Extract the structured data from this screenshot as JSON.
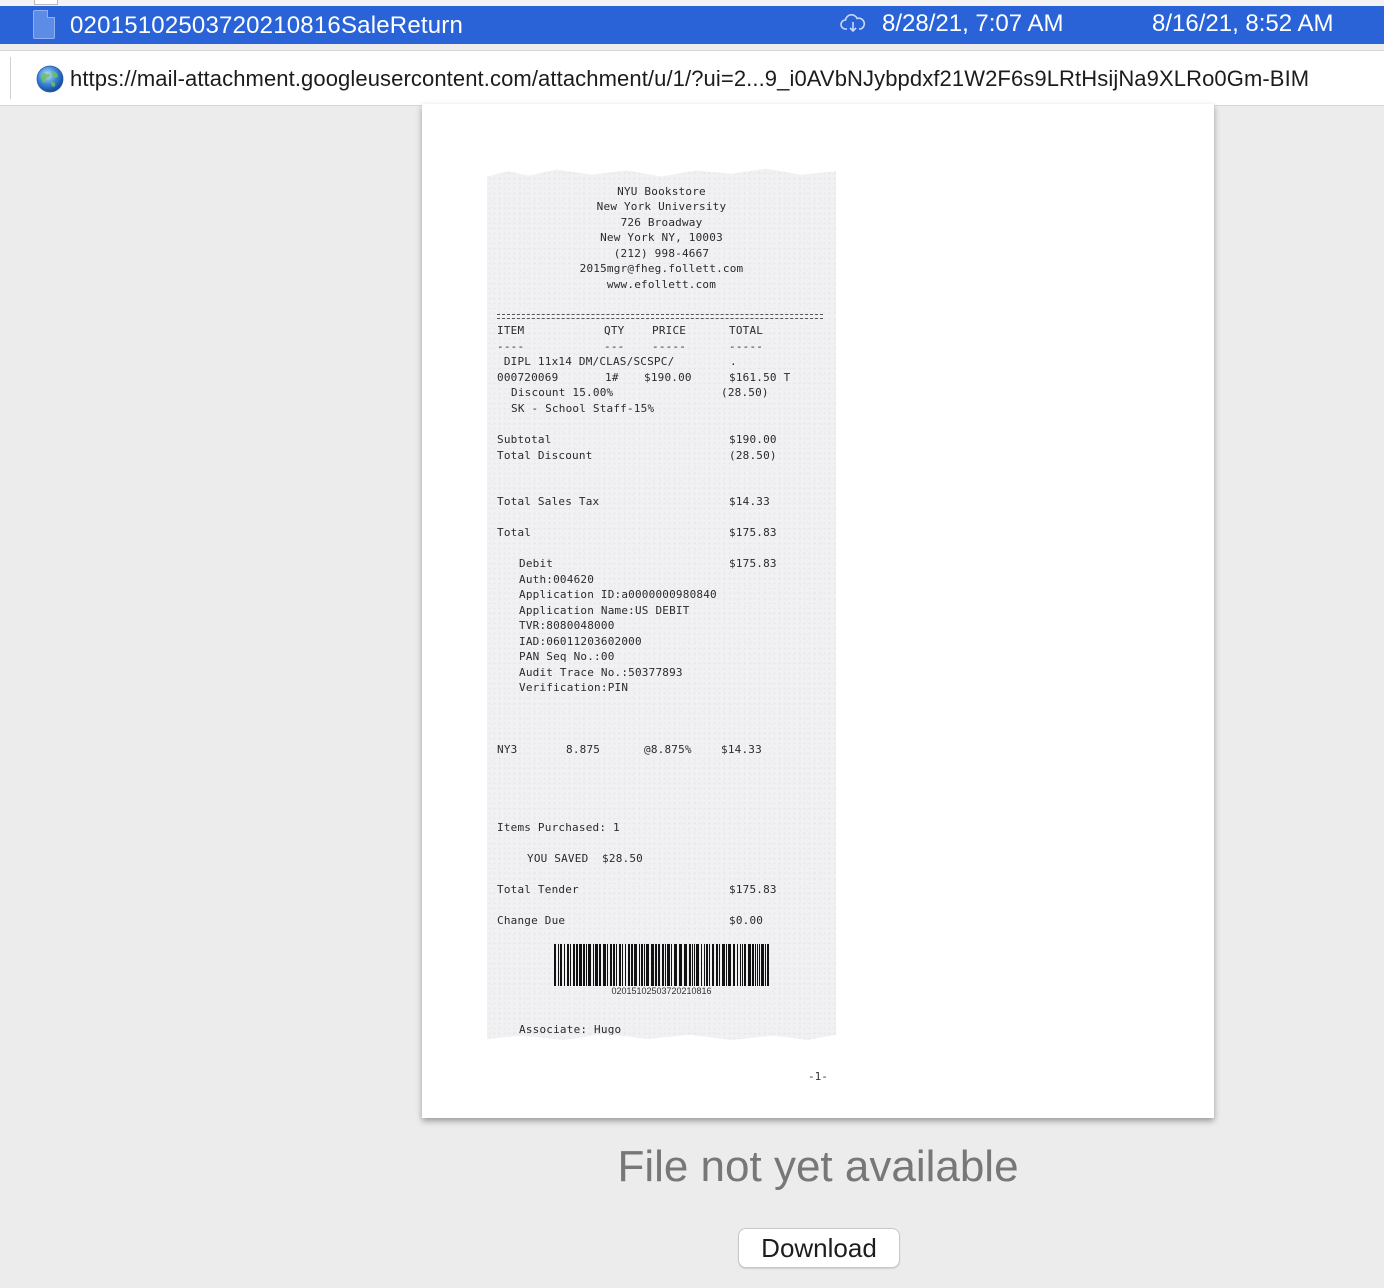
{
  "file_row": {
    "name": "02015102503720210816SaleReturn",
    "date_modified": "8/28/21, 7:07 AM",
    "date_created": "8/16/21, 8:52 AM",
    "status_icon": "cloud-download-icon"
  },
  "url_bar": {
    "url": "https://mail-attachment.googleusercontent.com/attachment/u/1/?ui=2...9_i0AVbNJybpdxf21W2F6s9LRtHsijNa9XLRo0Gm-BIM"
  },
  "receipt": {
    "header": [
      "NYU Bookstore",
      "New York University",
      "726 Broadway",
      "New York NY, 10003",
      "(212) 998-4667",
      "2015mgr@fheg.follett.com",
      "www.efollett.com"
    ],
    "columns": {
      "item": "ITEM",
      "qty": "QTY",
      "price": "PRICE",
      "total": "TOTAL"
    },
    "column_dashes": {
      "item": "----",
      "qty": "---",
      "price": "-----",
      "total": "-----"
    },
    "item_line1": " DIPL 11x14 DM/CLAS/SCSPC/",
    "item_line1_end": ".",
    "item_sku": "000720069",
    "item_qty": "1#",
    "item_price": "$190.00",
    "item_total": "$161.50 T",
    "discount_label": "Discount 15.00%",
    "discount_amount": "(28.50)",
    "discount_reason": "SK - School Staff-15%",
    "subtotal_label": "Subtotal",
    "subtotal_value": "$190.00",
    "total_discount_label": "Total Discount",
    "total_discount_value": "(28.50)",
    "sales_tax_label": "Total Sales Tax",
    "sales_tax_value": "$14.33",
    "total_label": "Total",
    "total_value": "$175.83",
    "debit_label": "Debit",
    "debit_value": "$175.83",
    "payment_details": [
      "Auth:004620",
      "Application ID:a0000000980840",
      "Application Name:US DEBIT",
      "TVR:8080048000",
      "IAD:06011203602000",
      "PAN Seq No.:00",
      "Audit Trace No.:50377893",
      "Verification:PIN"
    ],
    "tax_row": {
      "code": "NY3",
      "rate": "8.875",
      "pct": "@8.875%",
      "amount": "$14.33"
    },
    "items_purchased": "Items Purchased: 1",
    "you_saved": "YOU SAVED  $28.50",
    "total_tender_label": "Total Tender",
    "total_tender_value": "$175.83",
    "change_due_label": "Change Due",
    "change_due_value": "$0.00",
    "barcode_number": "02015102503720210816",
    "associate": "Associate: Hugo"
  },
  "page_number": "-1-",
  "status_message": "File not yet available",
  "download_label": "Download"
}
